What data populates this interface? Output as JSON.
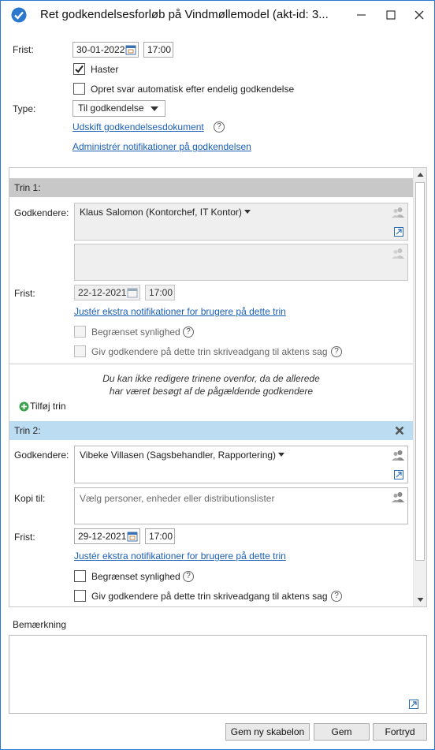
{
  "window": {
    "title": "Ret godkendelsesforløb på Vindmøllemodel (akt-id: 3...",
    "minimize_icon": "minimize-icon",
    "maximize_icon": "maximize-icon",
    "close_icon": "close-icon"
  },
  "form": {
    "deadline_label": "Frist:",
    "deadline_date": "30-01-2022",
    "deadline_time": "17:00",
    "urgent_label": "Haster",
    "urgent_checked": true,
    "auto_reply_label": "Opret svar automatisk efter endelig godkendelse",
    "auto_reply_checked": false,
    "type_label": "Type:",
    "type_value": "Til godkendelse",
    "replace_doc_link": "Udskift godkendelsesdokument",
    "manage_notifications_link": "Administrér notifikationer på godkendelsen"
  },
  "steps": [
    {
      "header": "Trin 1:",
      "approvers_label": "Godkendere:",
      "approvers_value": "Klaus Salomon (Kontorchef, IT Kontor)",
      "deadline_label": "Frist:",
      "deadline_date": "22-12-2021",
      "deadline_time": "17:00",
      "extra_notifications_link": "Justér ekstra notifikationer for brugere på dette trin",
      "limited_visibility_label": "Begrænset synlighed",
      "write_access_label": "Giv godkendere på dette trin skriveadgang til aktens sag",
      "locked": true
    },
    {
      "header": "Trin 2:",
      "approvers_label": "Godkendere:",
      "approvers_value": "Vibeke Villasen (Sagsbehandler, Rapportering)",
      "copy_label": "Kopi til:",
      "copy_placeholder": "Vælg personer, enheder eller distributionslister",
      "deadline_label": "Frist:",
      "deadline_date": "29-12-2021",
      "deadline_time": "17:00",
      "extra_notifications_link": "Justér ekstra notifikationer for brugere på dette trin",
      "limited_visibility_label": "Begrænset synlighed",
      "write_access_label": "Giv godkendere på dette trin skriveadgang til aktens sag",
      "locked": false
    }
  ],
  "locked_note_line1": "Du kan ikke redigere trinene ovenfor, da de allerede",
  "locked_note_line2": "har været besøgt af de pågældende godkendere",
  "add_step_label": "Tilføj trin",
  "remark_label": "Bemærkning",
  "buttons": {
    "save_template": "Gem ny skabelon",
    "save": "Gem",
    "cancel": "Fortryd"
  },
  "colors": {
    "accent": "#2b78d0",
    "link": "#1a5fb4",
    "step_locked_header": "#c8c8c8",
    "step_active_header": "#bcdcf2"
  }
}
